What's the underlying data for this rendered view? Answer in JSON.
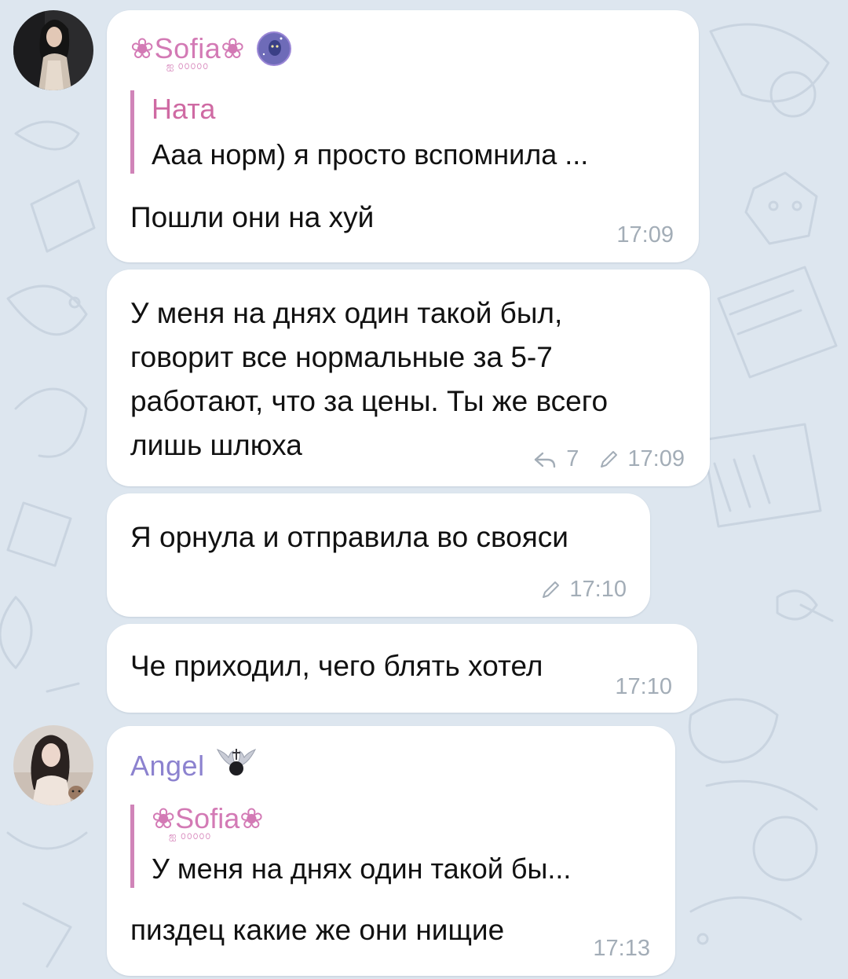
{
  "colors": {
    "background": "#dde6ef",
    "bubble": "#ffffff",
    "sofia_name": "#d37ab5",
    "nata_name": "#cf6aa3",
    "angel_name": "#8c82cf",
    "reply_bar": "#d084b8",
    "meta_text": "#a3adb7"
  },
  "messages": [
    {
      "sender_name": "❀Sofia❀",
      "sender_sub": "ஐ ௦௦௦௦௦",
      "sender_emoji_icon": "moon-face-icon",
      "reply": {
        "name": "Ната",
        "text": "Ааа норм) я просто вспомнила ..."
      },
      "text": "Пошли они на хуй",
      "time": "17:09"
    },
    {
      "text": "У меня на днях один такой был,\nговорит все нормальные за 5-7\nработают, что за цены. Ты же всего\nлишь шлюха",
      "replies": "7",
      "replies_icon": "reply-arrow-icon",
      "edited_icon": "pencil-icon",
      "time": "17:09"
    },
    {
      "text": "Я орнула и отправила во свояси",
      "edited_icon": "pencil-icon",
      "time": "17:10"
    },
    {
      "text": "Че приходил, чего блять хотел",
      "time": "17:10"
    },
    {
      "sender_name": "Angel",
      "sender_emoji_icon": "winged-cross-icon",
      "reply": {
        "name": "❀Sofia❀",
        "sub": "ஐ ௦௦௦௦௦",
        "text": "У меня на днях один такой бы..."
      },
      "text": "пиздец какие же они нищие",
      "time": "17:13"
    }
  ]
}
